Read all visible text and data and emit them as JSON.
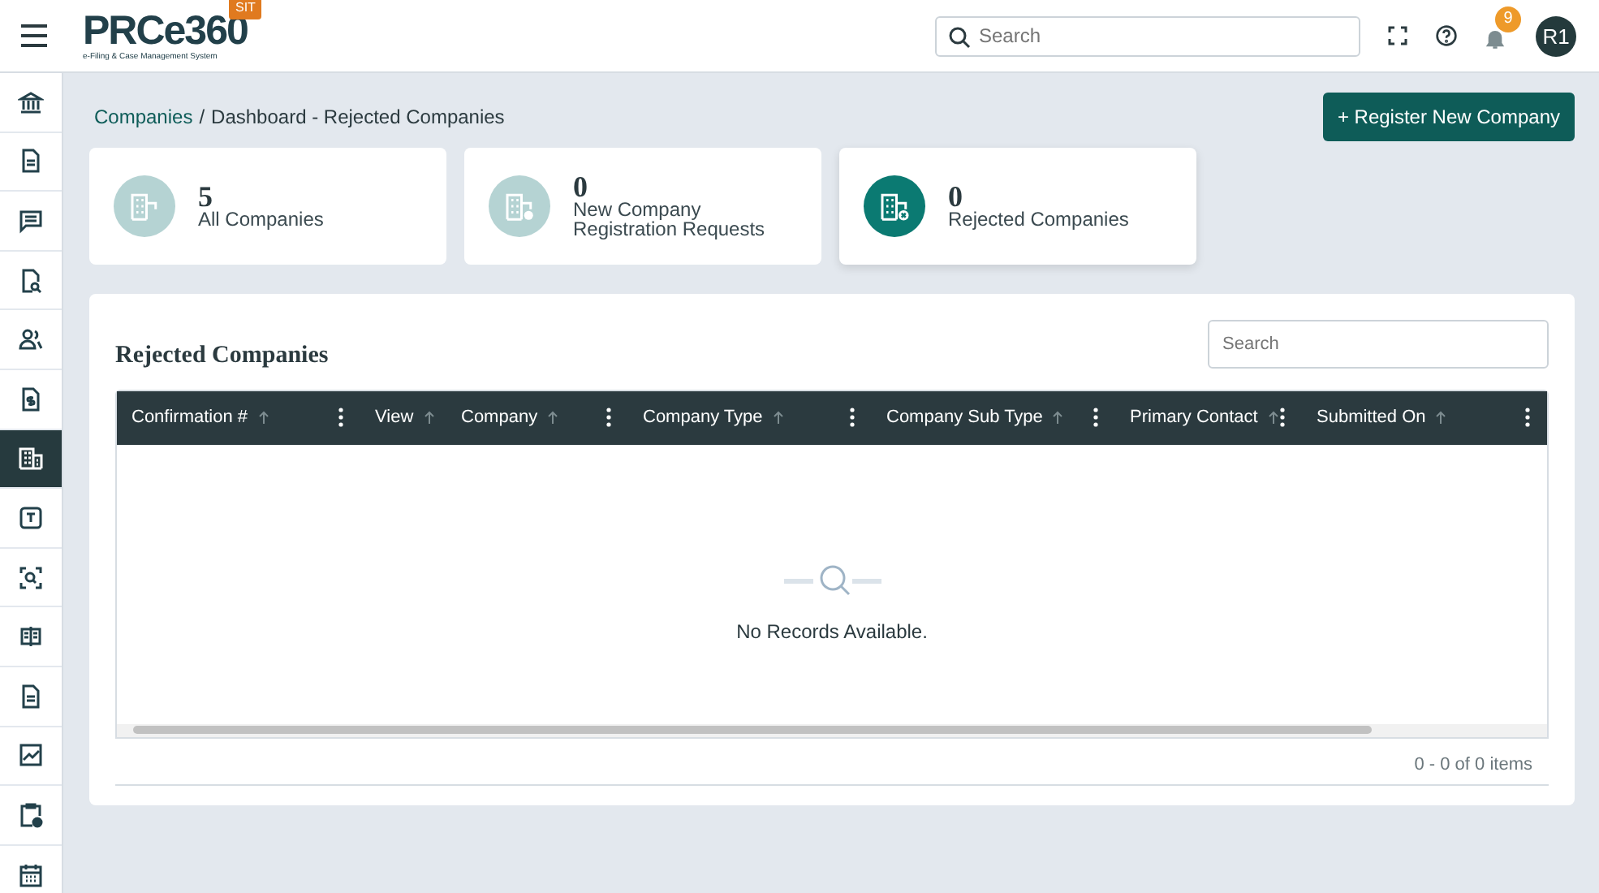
{
  "header": {
    "logo": "PRCe360",
    "logo_subtitle": "e-Filing & Case Management System",
    "env_badge": "SIT",
    "search": {
      "placeholder": "Search"
    },
    "notifications": "9",
    "avatar": "R1"
  },
  "sidebar": {
    "items": [
      {
        "selected": false
      },
      {
        "selected": false
      },
      {
        "selected": false
      },
      {
        "selected": false
      },
      {
        "selected": false
      },
      {
        "selected": false
      },
      {
        "selected": true
      },
      {
        "selected": false
      },
      {
        "selected": false
      },
      {
        "selected": false
      },
      {
        "selected": false
      },
      {
        "selected": false
      },
      {
        "selected": false
      },
      {
        "selected": false
      }
    ]
  },
  "breadcrumb": [
    {
      "label": "Companies",
      "link": true
    },
    {
      "label": "Dashboard - Rejected Companies",
      "link": false
    }
  ],
  "breadcrumb_separator": "/",
  "register_button": "+ Register New Company",
  "summary_cards": [
    {
      "count": "5",
      "label": "All Companies",
      "selected": false
    },
    {
      "count": "0",
      "label": "New Company Registration Requests",
      "selected": false
    },
    {
      "count": "0",
      "label": "Rejected Companies",
      "selected": true
    }
  ],
  "panel": {
    "title": "Rejected Companies",
    "search": {
      "placeholder": "Search"
    },
    "columns": [
      {
        "label": "Confirmation #",
        "menu": true
      },
      {
        "label": "View",
        "menu": false
      },
      {
        "label": "Company",
        "menu": true
      },
      {
        "label": "Company Type",
        "menu": true
      },
      {
        "label": "Company Sub Type",
        "menu": true
      },
      {
        "label": "Primary Contact",
        "menu": true
      },
      {
        "label": "Submitted On",
        "menu": true
      }
    ],
    "empty_message": "No Records Available.",
    "pager": "0 - 0 of 0 items"
  }
}
